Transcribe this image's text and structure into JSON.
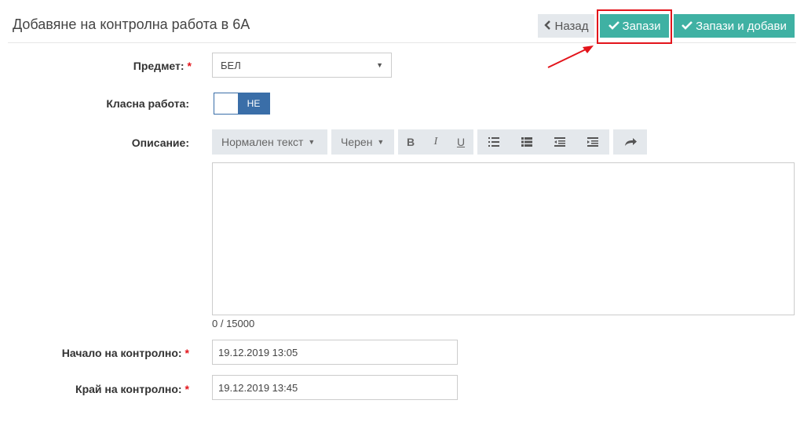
{
  "page": {
    "title": "Добавяне на контролна работа в 6А"
  },
  "toolbar": {
    "back_label": "Назад",
    "save_label": "Запази",
    "save_add_label": "Запази и добави"
  },
  "form": {
    "subject": {
      "label": "Предмет:",
      "required_mark": "*",
      "value": "БЕЛ"
    },
    "classwork": {
      "label": "Класна работа:",
      "toggle_value": "НЕ"
    },
    "description": {
      "label": "Описание:",
      "format_dropdown": "Нормален текст",
      "color_dropdown": "Черен",
      "bold": "B",
      "italic": "I",
      "underline": "U",
      "value": "",
      "counter": "0 / 15000"
    },
    "start": {
      "label": "Начало на контролно:",
      "required_mark": "*",
      "value": "19.12.2019 13:05"
    },
    "end": {
      "label": "Край на контролно:",
      "required_mark": "*",
      "value": "19.12.2019 13:45"
    }
  },
  "icons": {
    "back": "chevron-left-icon",
    "check": "check-icon",
    "bullet_list": "bullet-list-icon",
    "numbered_list": "numbered-list-icon",
    "outdent": "outdent-icon",
    "indent": "indent-icon",
    "redo": "redo-icon"
  },
  "colors": {
    "accent": "#3fb1a3",
    "toggle": "#3a6ea8",
    "required": "#e3141b",
    "toolbar_bg": "#e4e8ec"
  }
}
